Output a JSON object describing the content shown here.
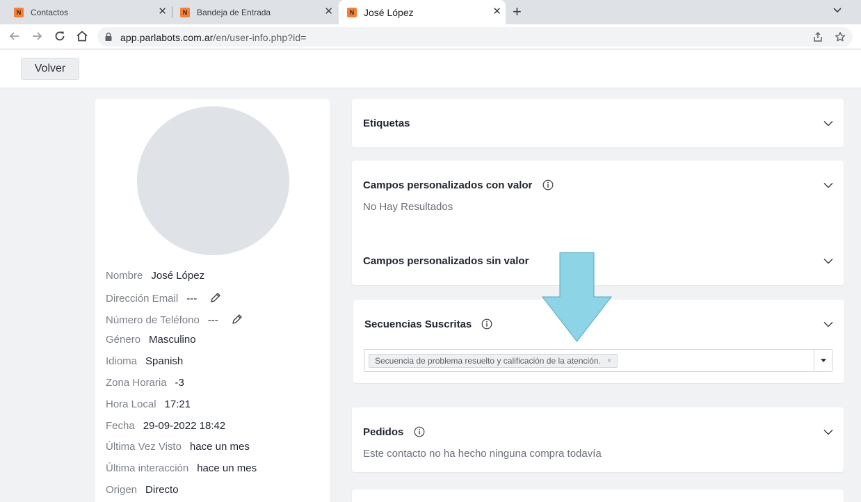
{
  "browser": {
    "tabs": [
      {
        "title": "Contactos",
        "favicon": "N",
        "active": false
      },
      {
        "title": "Bandeja de Entrada",
        "favicon": "N",
        "active": false
      },
      {
        "title": "José López",
        "favicon": "N",
        "active": true
      }
    ],
    "url_host": "app.parlabots.com.ar",
    "url_path": "/en/user-info.php?id="
  },
  "header": {
    "back_label": "Volver"
  },
  "profile": {
    "fields": [
      {
        "label": "Nombre",
        "value": "José López",
        "editable": false
      },
      {
        "label": "Dirección Email",
        "value": "---",
        "editable": true
      },
      {
        "label": "Número de Teléfono",
        "value": "---",
        "editable": true
      },
      {
        "label": "Género",
        "value": "Masculino",
        "editable": false
      },
      {
        "label": "Idioma",
        "value": "Spanish",
        "editable": false
      },
      {
        "label": "Zona Horaria",
        "value": "-3",
        "editable": false
      },
      {
        "label": "Hora Local",
        "value": "17:21",
        "editable": false
      },
      {
        "label": "Fecha",
        "value": "29-09-2022 18:42",
        "editable": false
      },
      {
        "label": "Última Vez Visto",
        "value": "hace un mes",
        "editable": false
      },
      {
        "label": "Última interacción",
        "value": "hace un mes",
        "editable": false
      },
      {
        "label": "Origen",
        "value": "Directo",
        "editable": false
      }
    ]
  },
  "cards": {
    "etiquetas": {
      "title": "Etiquetas"
    },
    "campos_con_valor": {
      "title": "Campos personalizados con valor",
      "empty_text": "No Hay Resultados"
    },
    "campos_sin_valor": {
      "title": "Campos personalizados sin valor"
    },
    "secuencias": {
      "title": "Secuencias Suscritas",
      "selected": [
        "Secuencia de problema resuelto y calificación de la atención."
      ],
      "remove_symbol": "×"
    },
    "pedidos": {
      "title": "Pedidos",
      "empty_text": "Este contacto no ha hecho ninguna compra todavía"
    }
  },
  "colors": {
    "favicon": "#f0813a",
    "annotation_arrow": "#8dd5e6",
    "avatar": "#dfe2e6"
  },
  "icons": [
    "back-arrow-icon",
    "forward-arrow-icon",
    "reload-icon",
    "home-icon",
    "lock-icon",
    "share-icon",
    "star-icon",
    "pencil-icon",
    "info-icon",
    "chevron-down-icon"
  ]
}
